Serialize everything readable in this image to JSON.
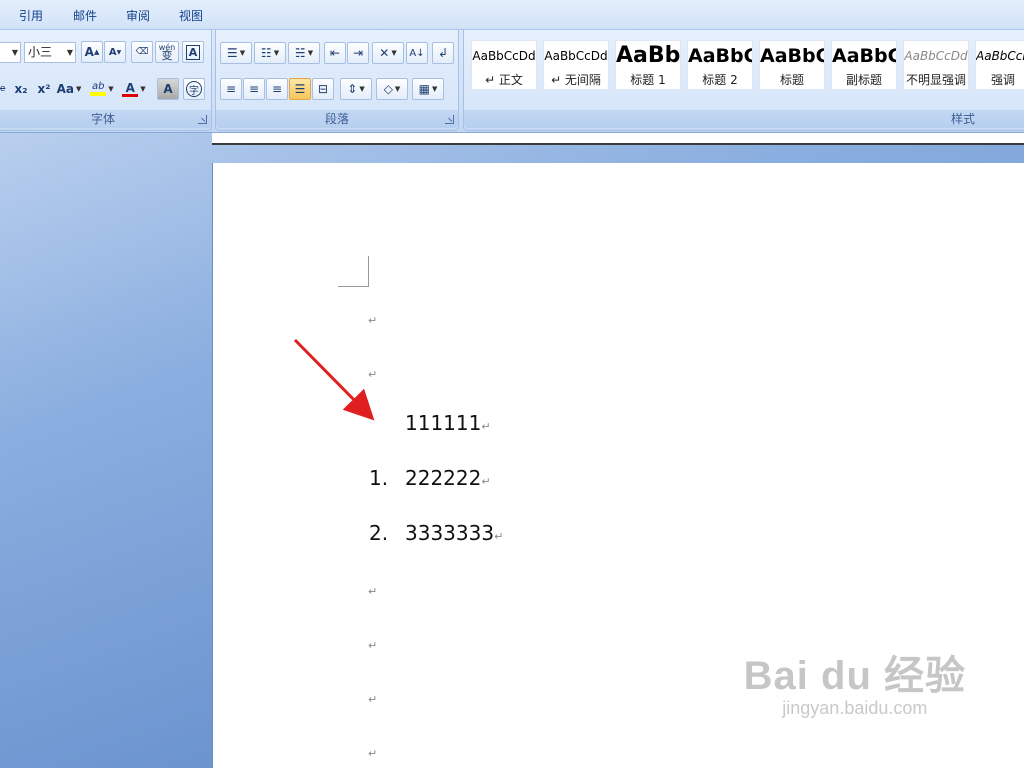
{
  "tabs": [
    "引用",
    "邮件",
    "审阅",
    "视图"
  ],
  "font_group": {
    "label": "字体",
    "font_size": "小三",
    "font_name_value": "",
    "grow_font": "A",
    "shrink_font": "A",
    "clear_format": "Aa",
    "phonetic": "wén",
    "char_border": "A",
    "strike": "abe",
    "subscript": "x₂",
    "superscript": "x²",
    "change_case": "Aa",
    "highlight": "ab",
    "font_color": "A",
    "char_shading": "A",
    "enclose": "字"
  },
  "paragraph_group": {
    "label": "段落"
  },
  "styles_group": {
    "label": "样式",
    "styles": [
      {
        "sample": "AaBbCcDd",
        "name": "↵ 正文"
      },
      {
        "sample": "AaBbCcDd",
        "name": "↵ 无间隔"
      },
      {
        "sample": "AaBb",
        "name": "标题 1"
      },
      {
        "sample": "AaBbC",
        "name": "标题 2"
      },
      {
        "sample": "AaBbC",
        "name": "标题"
      },
      {
        "sample": "AaBbC",
        "name": "副标题"
      },
      {
        "sample": "AaBbCcDd",
        "name": "不明显强调"
      },
      {
        "sample": "AaBbCcDd",
        "name": "强调"
      }
    ]
  },
  "document": {
    "para_mark": "↵",
    "lines": [
      {
        "number": "",
        "text": "111111"
      },
      {
        "number": "1.",
        "text": "222222"
      },
      {
        "number": "2.",
        "text": "3333333"
      }
    ]
  },
  "watermark": {
    "logo": "Bai du 经验",
    "url": "jingyan.baidu.com"
  },
  "colors": {
    "arrow": "#e02020",
    "font_color_bar": "#e00000",
    "highlight_bar": "#ffff00"
  }
}
